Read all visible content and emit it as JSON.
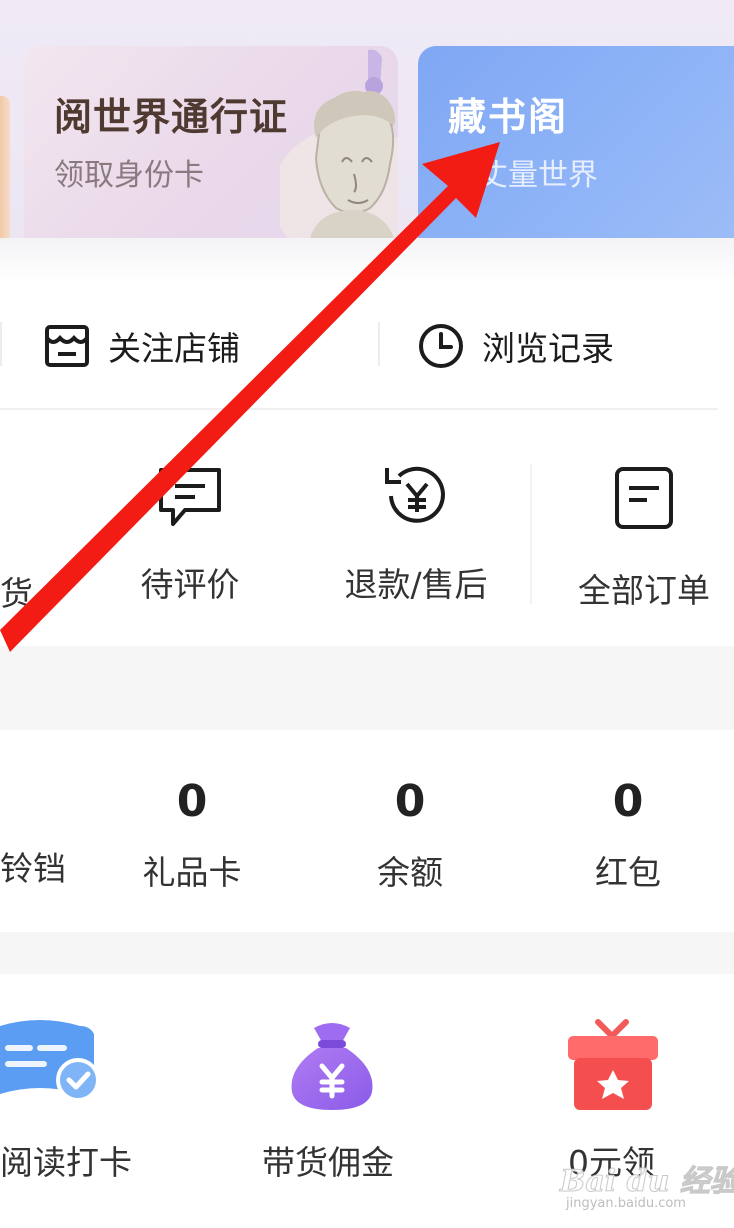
{
  "cards": {
    "pass_title": "阅世界通行证",
    "pass_sub": "领取身份卡",
    "shelf_title": "藏书阁",
    "shelf_sub": "读丈量世界"
  },
  "quick_links": {
    "shop": "关注店铺",
    "history": "浏览记录"
  },
  "orders": {
    "partial_left": "货",
    "review": "待评价",
    "refund": "退款/售后",
    "all": "全部订单"
  },
  "assets": {
    "partial_left": "铃铛",
    "gift_card": {
      "value": "0",
      "label": "礼品卡"
    },
    "balance": {
      "value": "0",
      "label": "余额"
    },
    "red_packet": {
      "value": "0",
      "label": "红包"
    }
  },
  "tools": {
    "reading": "阅读打卡",
    "commission": "带货佣金",
    "free": "0元领"
  },
  "watermark": {
    "brand": "Bai du 经验",
    "url": "jingyan.baidu.com"
  },
  "colors": {
    "annotation_arrow": "#f21c14",
    "shelf_card": "#8fb4f7",
    "pass_card": "#ead9ea"
  }
}
